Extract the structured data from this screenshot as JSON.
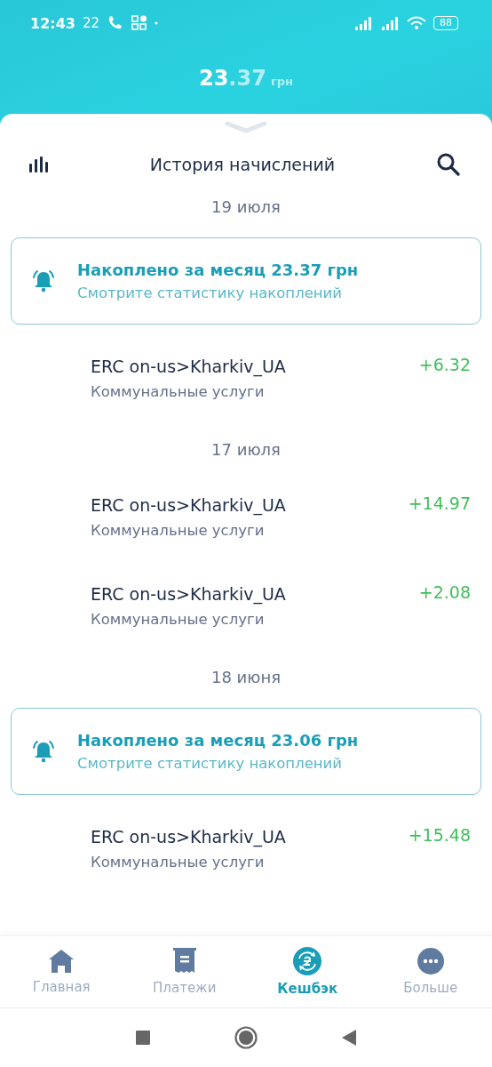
{
  "status_bar": {
    "time": "12:43",
    "temperature": "22",
    "battery": "88"
  },
  "balance": {
    "integer": "23",
    "fraction": ".37",
    "currency": "грн"
  },
  "header": {
    "title": "История начислений"
  },
  "items": [
    {
      "kind": "date",
      "text": "19 июля"
    },
    {
      "kind": "summary",
      "title": "Накоплено за месяц 23.37 грн",
      "subtitle": "Смотрите статистику накоплений"
    },
    {
      "kind": "transaction",
      "title": "ERC on-us>Kharkiv_UA",
      "subtitle": "Коммунальные услуги",
      "amount": "+6.32"
    },
    {
      "kind": "date",
      "text": "17 июля"
    },
    {
      "kind": "transaction",
      "title": "ERC on-us>Kharkiv_UA",
      "subtitle": "Коммунальные услуги",
      "amount": "+14.97"
    },
    {
      "kind": "transaction",
      "title": "ERC on-us>Kharkiv_UA",
      "subtitle": "Коммунальные услуги",
      "amount": "+2.08"
    },
    {
      "kind": "date",
      "text": "18 июня"
    },
    {
      "kind": "summary",
      "title": "Накоплено за месяц 23.06 грн",
      "subtitle": "Смотрите статистику накоплений"
    },
    {
      "kind": "transaction",
      "title": "ERC on-us>Kharkiv_UA",
      "subtitle": "Коммунальные услуги",
      "amount": "+15.48"
    }
  ],
  "bottom_nav": [
    {
      "kind": "home",
      "label": "Главная",
      "selected": false
    },
    {
      "kind": "payments",
      "label": "Платежи",
      "selected": false
    },
    {
      "kind": "cashback",
      "label": "Кешбэк",
      "selected": true
    },
    {
      "kind": "more",
      "label": "Больше",
      "selected": false
    }
  ]
}
